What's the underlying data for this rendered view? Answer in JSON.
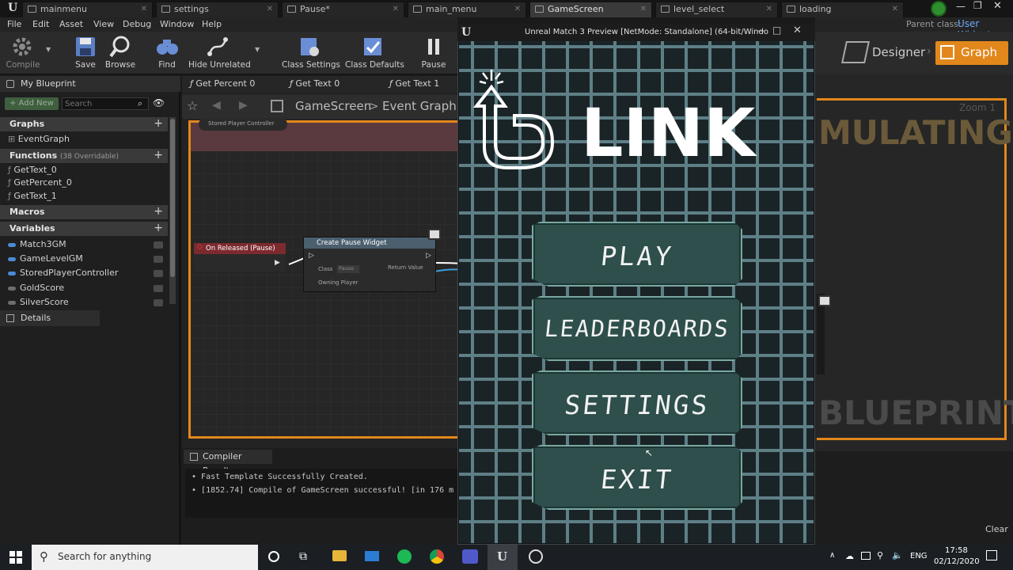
{
  "tabs": [
    {
      "label": "mainmenu",
      "active": false
    },
    {
      "label": "settings",
      "active": false
    },
    {
      "label": "Pause*",
      "active": false
    },
    {
      "label": "main_menu",
      "active": false
    },
    {
      "label": "GameScreen",
      "active": true
    },
    {
      "label": "level_select",
      "active": false
    },
    {
      "label": "loading",
      "active": false
    }
  ],
  "menubar": [
    "File",
    "Edit",
    "Asset",
    "View",
    "Debug",
    "Window",
    "Help"
  ],
  "parent_class": {
    "label": "Parent class:",
    "value": "User Widget"
  },
  "toolbar": [
    "Compile",
    "Save",
    "Browse",
    "Find",
    "Hide Unrelated",
    "Class Settings",
    "Class Defaults",
    "Pause"
  ],
  "mode": {
    "designer": "Designer",
    "graph": "Graph"
  },
  "my_blueprint": {
    "title": "My Blueprint",
    "add_new": "+ Add New",
    "search_placeholder": "Search",
    "graphs_label": "Graphs",
    "graphs": [
      "EventGraph"
    ],
    "functions_label": "Functions",
    "functions_sub": "(38 Overridable)",
    "functions": [
      "GetText_0",
      "GetPercent_0",
      "GetText_1"
    ],
    "macros_label": "Macros",
    "variables_label": "Variables",
    "variables": [
      "Match3GM",
      "GameLevelGM",
      "StoredPlayerController",
      "GoldScore",
      "SilverScore"
    ],
    "details": "Details"
  },
  "graph_tabs": [
    "Get Percent 0",
    "Get Text 0",
    "Get Text 1"
  ],
  "breadcrumb": {
    "root": "GameScreen",
    "leaf": "Event Graph"
  },
  "nodes": {
    "stored": "Stored Player Controller",
    "event": "On Released (Pause)",
    "create": "Create Pause Widget",
    "class_pin": "Class",
    "class_val": "Pause",
    "owning": "Owning Player",
    "ret": "Return Value"
  },
  "compiler": {
    "title": "Compiler Results",
    "lines": [
      "Fast Template Successfully Created.",
      "[1852.74] Compile of GameScreen successful! [in 176 m"
    ],
    "clear": "Clear"
  },
  "preview": {
    "title": "Unreal Match 3 Preview [NetMode: Standalone] (64-bit/Windo",
    "logo": "LINK",
    "buttons": [
      "PLAY",
      "LEADERBOARDS",
      "SETTINGS",
      "EXIT"
    ]
  },
  "right_graph": {
    "zoom": "Zoom 1",
    "sim": "MULATING",
    "bp": "BLUEPRINT"
  },
  "taskbar": {
    "search": "Search for anything",
    "lang": "ENG",
    "time": "17:58",
    "date": "02/12/2020"
  },
  "colors": {
    "accent": "#e2871b",
    "grid": "#5e7f86",
    "button": "#2e4f4c"
  }
}
